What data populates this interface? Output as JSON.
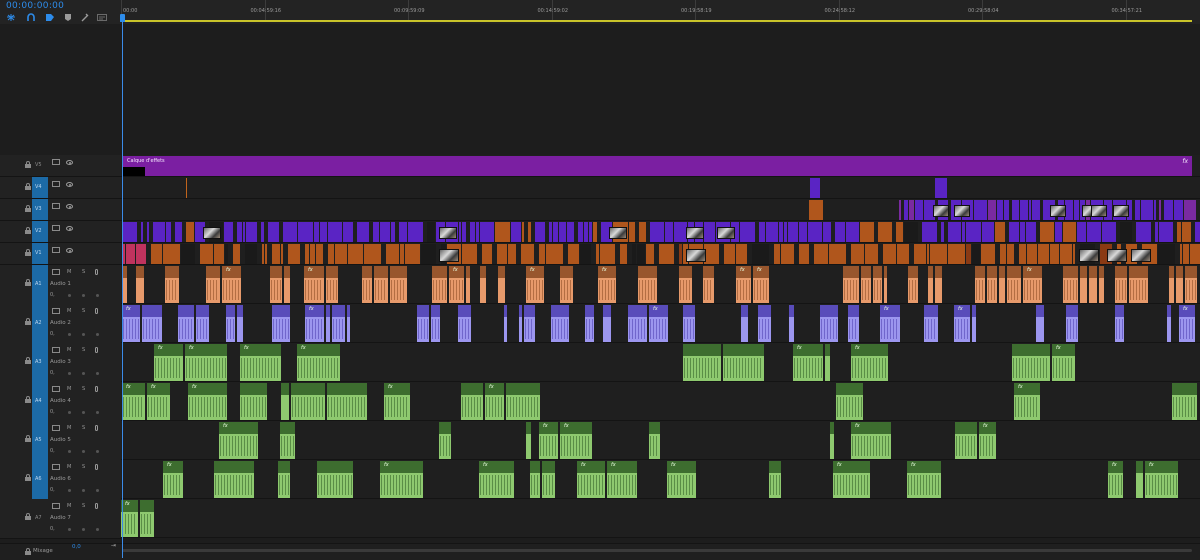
{
  "timecode": "00:00:00:00",
  "toolbar": {
    "icons": [
      "snap-icon",
      "magnet-icon",
      "linked-selection-icon",
      "marker-icon",
      "wrench-icon",
      "captions-icon"
    ]
  },
  "ruler": {
    "ticks": [
      "00:00",
      "00:04:59:16",
      "00:09:59:09",
      "00:14:59:02",
      "00:19:58:19",
      "00:24:58:12",
      "00:29:58:04",
      "00:34:57:21"
    ]
  },
  "video_tracks": [
    {
      "id": "V5",
      "clip_label": "Calque d'effets",
      "fx": "fx"
    },
    {
      "id": "V4"
    },
    {
      "id": "V3"
    },
    {
      "id": "V2"
    },
    {
      "id": "V1"
    }
  ],
  "audio_tracks": [
    {
      "id": "A1",
      "name": "Audio 1",
      "m": "M",
      "s": "S",
      "vol": "0,"
    },
    {
      "id": "A2",
      "name": "Audio 2",
      "m": "M",
      "s": "S",
      "vol": "0,"
    },
    {
      "id": "A3",
      "name": "Audio 3",
      "m": "M",
      "s": "S",
      "vol": "0,"
    },
    {
      "id": "A4",
      "name": "Audio 4",
      "m": "M",
      "s": "S",
      "vol": "0,"
    },
    {
      "id": "A5",
      "name": "Audio 5",
      "m": "M",
      "s": "S",
      "vol": "0,"
    },
    {
      "id": "A6",
      "name": "Audio 6",
      "m": "M",
      "s": "S",
      "vol": "0,"
    },
    {
      "id": "A7",
      "name": "Audio 7",
      "m": "M",
      "s": "S",
      "vol": "0,"
    }
  ],
  "footer": {
    "mix_label": "Mixage",
    "mix_value": "0,0",
    "end_icon": "⇥"
  },
  "colors": {
    "adjustment": "#7b1fa2",
    "video_orange": "#b0561c",
    "video_violet": "#5a24c4",
    "audio_peach": "#e79a6b",
    "audio_lavender": "#9c96ef",
    "audio_green": "#8ec96f",
    "audio_dark_green": "#2f5d25",
    "timecode_blue": "#2d8ceb"
  }
}
